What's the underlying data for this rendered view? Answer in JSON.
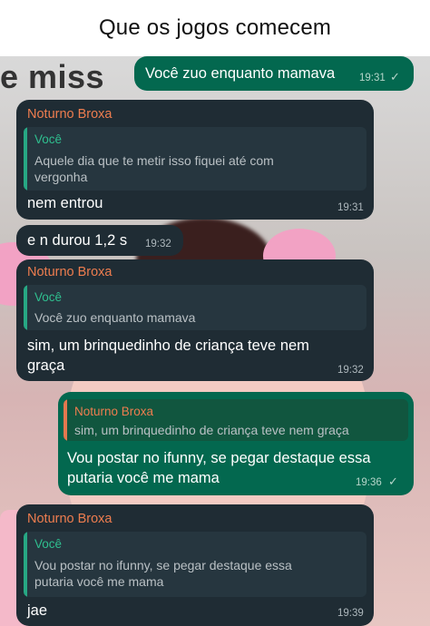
{
  "caption": "Que os jogos comecem",
  "background_text": "e miss",
  "messages": [
    {
      "text": "Você zuo enquanto mamava",
      "time": "19:31",
      "status": "✓"
    },
    {
      "sender": "Noturno Broxa",
      "quote_author": "Você",
      "quote_line1": "Aquele dia que te metir isso fiquei até com",
      "quote_line2": "vergonha",
      "text": "nem entrou",
      "time": "19:31"
    },
    {
      "text": "e n durou 1,2 s",
      "time": "19:32"
    },
    {
      "sender": "Noturno Broxa",
      "quote_author": "Você",
      "quote_line1": "Você zuo enquanto mamava",
      "text_line1": "sim, um brinquedinho de criança teve nem",
      "text_line2": "graça",
      "time": "19:32"
    },
    {
      "quote_author": "Noturno Broxa",
      "quote_line1": "sim, um brinquedinho de criança teve nem graça",
      "text_line1": "Vou postar no ifunny, se pegar destaque essa",
      "text_line2": "putaria você me mama",
      "time": "19:36",
      "status": "✓"
    },
    {
      "sender": "Noturno Broxa",
      "quote_author": "Você",
      "quote_line1": "Vou postar no ifunny, se pegar destaque essa",
      "quote_line2": "putaria você me mama",
      "text": "jae",
      "time": "19:39"
    }
  ],
  "colors": {
    "incoming_bubble": "#1f2c34",
    "outgoing_bubble": "#03684f",
    "sender_name": "#ee7d4f",
    "quote_author_in": "#2fbf8f"
  }
}
